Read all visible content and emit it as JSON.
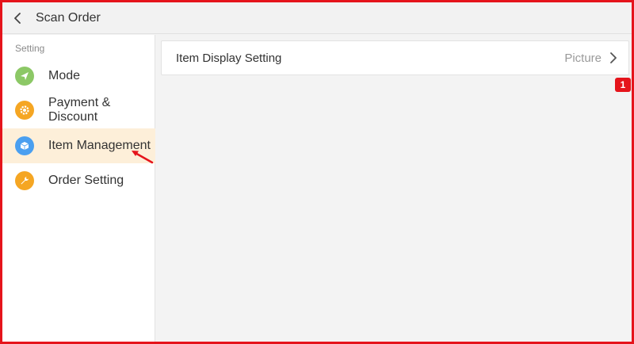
{
  "header": {
    "title": "Scan Order",
    "back_icon": "chevron-left-icon"
  },
  "sidebar": {
    "section_label": "Setting",
    "items": [
      {
        "label": "Mode",
        "icon": "send-icon",
        "color": "#8cc866"
      },
      {
        "label": "Payment &\nDiscount",
        "icon": "gear-icon",
        "color": "#f5a623"
      },
      {
        "label": "Item Management",
        "icon": "cube-icon",
        "color": "#4a9ff0",
        "active": true
      },
      {
        "label": "Order Setting",
        "icon": "wrench-icon",
        "color": "#f5a623"
      }
    ]
  },
  "content": {
    "rows": [
      {
        "label": "Item Display Setting",
        "value": "Picture"
      }
    ]
  },
  "annotation": {
    "badge": "1"
  },
  "colors": {
    "accent_red": "#e5141b",
    "active_bg": "#fdefd9"
  }
}
